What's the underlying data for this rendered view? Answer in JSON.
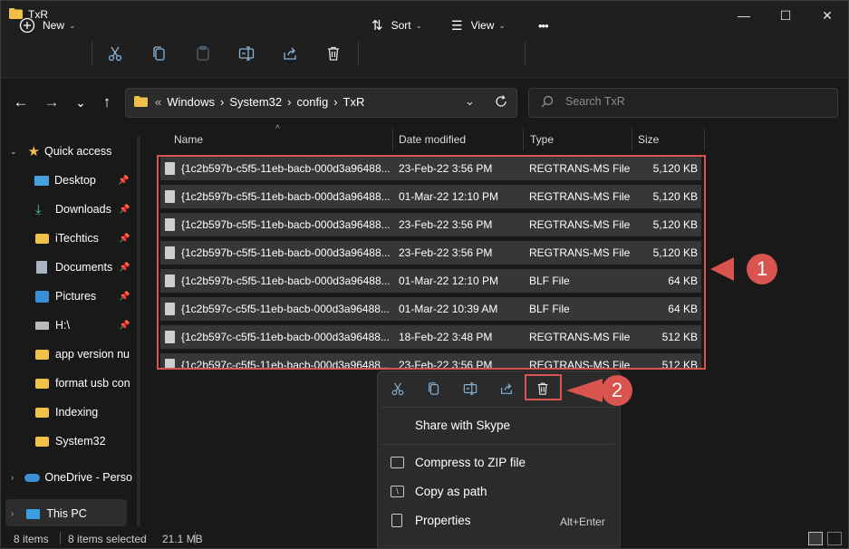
{
  "window": {
    "title": "TxR"
  },
  "controls": {
    "minimize": "—",
    "maximize": "☐",
    "close": "✕"
  },
  "commandbar": {
    "new_label": "New",
    "sort_label": "Sort",
    "view_label": "View",
    "more_label": "•••"
  },
  "nav": {
    "back": "←",
    "forward": "→",
    "dropdown": "⌄",
    "up": "↑"
  },
  "address": {
    "prefix": "«",
    "crumbs": [
      "Windows",
      "System32",
      "config",
      "TxR"
    ],
    "separator": "›"
  },
  "search": {
    "placeholder": "Search TxR"
  },
  "sidebar": {
    "quick_access": "Quick access",
    "items": [
      {
        "label": "Desktop",
        "icon": "desktop-icon",
        "pinned": true
      },
      {
        "label": "Downloads",
        "icon": "download-icon",
        "pinned": true
      },
      {
        "label": "iTechtics",
        "icon": "folder-icon",
        "pinned": true
      },
      {
        "label": "Documents",
        "icon": "documents-icon",
        "pinned": true
      },
      {
        "label": "Pictures",
        "icon": "pictures-icon",
        "pinned": true
      },
      {
        "label": "H:\\",
        "icon": "drive-icon",
        "pinned": true
      },
      {
        "label": "app version nu",
        "icon": "folder-icon",
        "pinned": false
      },
      {
        "label": "format usb con",
        "icon": "folder-icon",
        "pinned": false
      },
      {
        "label": "Indexing",
        "icon": "folder-icon",
        "pinned": false
      },
      {
        "label": "System32",
        "icon": "folder-icon",
        "pinned": false
      }
    ],
    "onedrive": "OneDrive - Perso",
    "this_pc": "This PC"
  },
  "columns": {
    "name": "Name",
    "date": "Date modified",
    "type": "Type",
    "size": "Size"
  },
  "files": [
    {
      "name": "{1c2b597b-c5f5-11eb-bacb-000d3a96488...",
      "date": "23-Feb-22 3:56 PM",
      "type": "REGTRANS-MS File",
      "size": "5,120 KB"
    },
    {
      "name": "{1c2b597b-c5f5-11eb-bacb-000d3a96488...",
      "date": "01-Mar-22 12:10 PM",
      "type": "REGTRANS-MS File",
      "size": "5,120 KB"
    },
    {
      "name": "{1c2b597b-c5f5-11eb-bacb-000d3a96488...",
      "date": "23-Feb-22 3:56 PM",
      "type": "REGTRANS-MS File",
      "size": "5,120 KB"
    },
    {
      "name": "{1c2b597b-c5f5-11eb-bacb-000d3a96488...",
      "date": "23-Feb-22 3:56 PM",
      "type": "REGTRANS-MS File",
      "size": "5,120 KB"
    },
    {
      "name": "{1c2b597b-c5f5-11eb-bacb-000d3a96488...",
      "date": "01-Mar-22 12:10 PM",
      "type": "BLF File",
      "size": "64 KB"
    },
    {
      "name": "{1c2b597c-c5f5-11eb-bacb-000d3a96488...",
      "date": "01-Mar-22 10:39 AM",
      "type": "BLF File",
      "size": "64 KB"
    },
    {
      "name": "{1c2b597c-c5f5-11eb-bacb-000d3a96488...",
      "date": "18-Feb-22 3:48 PM",
      "type": "REGTRANS-MS File",
      "size": "512 KB"
    },
    {
      "name": "{1c2b597c-c5f5-11eb-bacb-000d3a96488...",
      "date": "23-Feb-22 3:56 PM",
      "type": "REGTRANS-MS File",
      "size": "512 KB"
    }
  ],
  "annotations": {
    "badge1": "1",
    "badge2": "2",
    "color": "#d9534f"
  },
  "context_menu": {
    "share_skype": "Share with Skype",
    "compress": "Compress to ZIP file",
    "copy_path": "Copy as path",
    "properties": "Properties",
    "properties_shortcut": "Alt+Enter"
  },
  "status": {
    "count": "8 items",
    "selected": "8 items selected",
    "size": "21.1 MB"
  },
  "colors": {
    "accent": "#60cdff",
    "folder": "#f0c04a",
    "selection": "#373737"
  }
}
